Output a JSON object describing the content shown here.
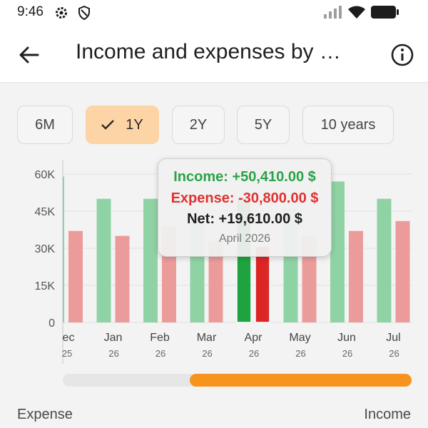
{
  "status_bar": {
    "time": "9:46"
  },
  "header": {
    "title": "Income and expenses by …"
  },
  "periods": [
    {
      "label": "6M",
      "selected": false
    },
    {
      "label": "1Y",
      "selected": true
    },
    {
      "label": "2Y",
      "selected": false
    },
    {
      "label": "5Y",
      "selected": false
    },
    {
      "label": "10 years",
      "selected": false
    }
  ],
  "tooltip": {
    "income": "Income: +50,410.00 $",
    "expense": "Expense: -30,800.00 $",
    "net": "Net: +19,610.00 $",
    "date": "April 2026"
  },
  "legend": {
    "left": "Expense",
    "right": "Income"
  },
  "scroll": {
    "visible_start": 0.37,
    "visible_end": 1.0
  },
  "colors": {
    "income": "#8fd3a5",
    "expense": "#ec9b9b",
    "income_selected": "#1fa340",
    "expense_selected": "#dc2626",
    "accent": "#f7941d",
    "chip_selected": "#fcd4a5"
  },
  "chart_data": {
    "type": "bar",
    "categories": [
      "ec",
      "Jan",
      "Feb",
      "Mar",
      "Apr",
      "May",
      "Jun",
      "Jul"
    ],
    "category_years": [
      "25",
      "26",
      "26",
      "26",
      "26",
      "26",
      "26",
      "26"
    ],
    "series": [
      {
        "name": "Income",
        "values": [
          59000,
          50000,
          50000,
          41000,
          50410,
          46000,
          57000,
          50000
        ]
      },
      {
        "name": "Expense",
        "values": [
          37000,
          35000,
          39000,
          33000,
          30800,
          35000,
          37000,
          41000
        ]
      }
    ],
    "y_ticks": [
      "0",
      "15K",
      "30K",
      "45K",
      "60K"
    ],
    "ylim": [
      0,
      60000
    ],
    "selected_category": "Apr",
    "grid": true
  }
}
